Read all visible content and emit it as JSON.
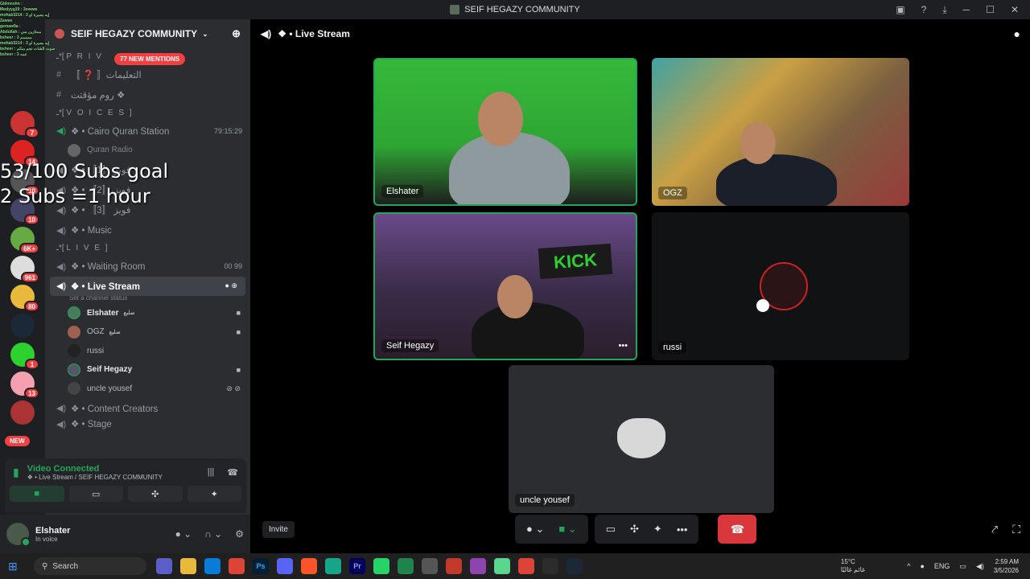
{
  "window": {
    "title": "SEIF HEGAZY COMMUNITY"
  },
  "stream_overlay": {
    "goal_line1": "53/100 Subs goal",
    "goal_line2": "2 Subs =1 hour",
    "chat_lines": [
      "Gldmnshn : ",
      "Modyyg19 : 3owww",
      "mohab3214 : 3 إيه بصيرة لو",
      "Zawee",
      "gemaw9a :",
      "Abdullah : ممتازين بس",
      "bsheer : 3 ممممم",
      "mohab3214 : 3 إيه بصيرة لو",
      "bsheer : صوت الشات نجم منكم",
      "bsheer : 3 عمه"
    ]
  },
  "server_list": {
    "badges": [
      "7",
      "14",
      "10",
      "10",
      "6K+",
      "961",
      "80",
      "1",
      "13"
    ],
    "new_label": "NEW"
  },
  "sidebar": {
    "guild_name": "SEIF HEGAZY COMMUNITY",
    "mentions_pill": "77 NEW MENTIONS",
    "items": [
      {
        "type": "cat",
        "label": "ـ*[ P R I V"
      },
      {
        "type": "text",
        "label": "〚 ❓ 〛التعليمات"
      },
      {
        "type": "text",
        "label": "روم مؤقتت ❖"
      },
      {
        "type": "cat",
        "label": "ـ*[ V O I C E S ]"
      },
      {
        "type": "voice",
        "label": "❖ • Cairo Quran Station",
        "right": "79:15:29"
      },
      {
        "type": "member",
        "label": "Quran Radio"
      },
      {
        "type": "voice",
        "label": "❖ • فويز 〚1〛"
      },
      {
        "type": "voice",
        "label": "❖ • فويز 〚2〛"
      },
      {
        "type": "voice",
        "label": "❖ • فويز 〚3〛"
      },
      {
        "type": "voice",
        "label": "❖ • Music"
      },
      {
        "type": "cat",
        "label": "ـ*[ L I V E ]"
      },
      {
        "type": "voice",
        "label": "❖ • Waiting Room",
        "right": "00  99"
      }
    ],
    "selected_channel": "❖ • Live Stream",
    "channel_status": "Set a channel status",
    "members": [
      {
        "name": "Elshater",
        "tag": "ضليع"
      },
      {
        "name": "OGZ",
        "tag": "ضليع"
      },
      {
        "name": "russi",
        "tag": ""
      },
      {
        "name": "Seif Hegazy",
        "tag": ""
      },
      {
        "name": "uncle yousef",
        "tag": ""
      }
    ],
    "more_channels": [
      "❖ • Content Creators",
      "❖ • Stage"
    ]
  },
  "voice_panel": {
    "title": "Video Connected",
    "subtitle": "❖ • Live Stream / SEIF HEGAZY COMMUNITY"
  },
  "user": {
    "name": "Elshater",
    "status": "In voice"
  },
  "main": {
    "channel_title": "❖ • Live Stream",
    "tiles": [
      "Elshater",
      "OGZ",
      "Seif Hegazy",
      "russi",
      "uncle yousef"
    ],
    "invite_label": "Invite"
  },
  "taskbar": {
    "search_placeholder": "Search",
    "weather_temp": "15°C",
    "weather_desc": "غائم غالبًا",
    "lang": "ENG",
    "time": "2:59 AM",
    "date": "3/5/2026"
  },
  "colors": {
    "accent_green": "#23a55a",
    "danger": "#da373c",
    "mention_red": "#f23f42"
  }
}
